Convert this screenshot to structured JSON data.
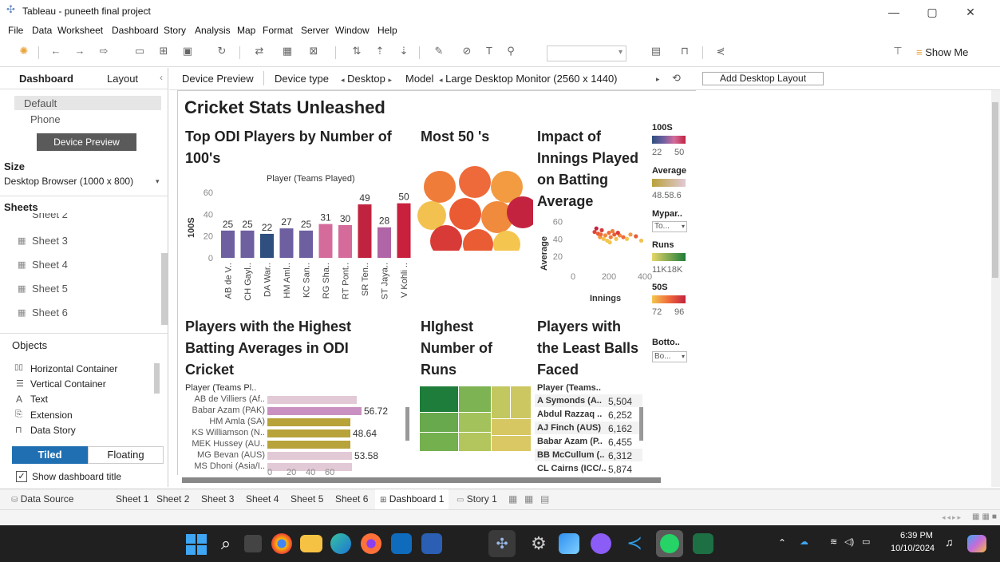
{
  "window": {
    "title": "Tableau - puneeth final project",
    "minimize": "—",
    "maximize": "▢",
    "close": "✕"
  },
  "menu": [
    "File",
    "Data",
    "Worksheet",
    "Dashboard",
    "Story",
    "Analysis",
    "Map",
    "Format",
    "Server",
    "Window",
    "Help"
  ],
  "toolbar": {
    "show_me": "Show Me"
  },
  "left": {
    "tab_dashboard": "Dashboard",
    "tab_layout": "Layout",
    "devices": [
      "Default",
      "Phone"
    ],
    "device_preview_btn": "Device Preview",
    "size_label": "Size",
    "size_value": "Desktop Browser (1000 x 800)",
    "sheets_label": "Sheets",
    "sheets": [
      "Sheet 2",
      "Sheet 3",
      "Sheet 4",
      "Sheet 5",
      "Sheet 6"
    ],
    "objects_label": "Objects",
    "objects": [
      "Horizontal Container",
      "Vertical Container",
      "Text",
      "Extension",
      "Data Story"
    ],
    "tiled": "Tiled",
    "floating": "Floating",
    "show_title": "Show dashboard title"
  },
  "devbar": {
    "device_preview": "Device Preview",
    "device_type_label": "Device type",
    "device_type": "Desktop",
    "model_label": "Model",
    "model": "Large Desktop Monitor (2560 x 1440)",
    "add_layout": "Add Desktop Layout"
  },
  "dashboard": {
    "title": "Cricket Stats Unleashed",
    "t1": "Top ODI Players by Number of 100's",
    "t1_sub": "Player (Teams Played)",
    "t1_ylabel": "100S",
    "t2": "Most 50 's",
    "t3": "Impact of Innings Played on Batting Average",
    "t3_ylabel": "Average",
    "t3_xlabel": "Innings",
    "t4": "Players with the Highest Batting Averages in ODI Cricket",
    "t4_header": "Player (Teams Pl..",
    "t5": "HIghest Number of Runs",
    "t6": "Players with the Least Balls Faced",
    "t6_header": "Player (Teams.."
  },
  "chart_data": [
    {
      "type": "bar",
      "title": "Top ODI Players by Number of 100's",
      "xlabel": "Player (Teams Played)",
      "ylabel": "100S",
      "categories": [
        "AB de V..",
        "CH Gayl..",
        "DA War..",
        "HM Aml..",
        "KC San..",
        "RG Sha..",
        "RT Pont..",
        "SR Ten..",
        "ST Jaya..",
        "V Kohli .."
      ],
      "values": [
        25,
        25,
        22,
        27,
        25,
        31,
        30,
        49,
        28,
        50
      ],
      "colors": [
        "#6e5fa0",
        "#6e5fa0",
        "#2f4f7f",
        "#6e5fa0",
        "#6e5fa0",
        "#d46b9b",
        "#d46b9b",
        "#c0233f",
        "#b065a6",
        "#c8203d"
      ],
      "ylim": [
        0,
        60
      ],
      "yticks": [
        0,
        20,
        40,
        60
      ]
    },
    {
      "type": "scatter",
      "title": "Impact of Innings Played on Batting Average",
      "xlabel": "Innings",
      "ylabel": "Average",
      "xticks": [
        0,
        200,
        400
      ],
      "yticks": [
        20,
        40,
        60
      ]
    },
    {
      "type": "bar",
      "title": "Players with the Highest Batting Averages in ODI Cricket",
      "categories": [
        "AB de Villiers (Af..",
        "Babar Azam (PAK)",
        "HM Amla (SA)",
        "KS Williamson (N..",
        "MEK Hussey (AU..",
        "MG Bevan (AUS)",
        "MS Dhoni (Asia/I.."
      ],
      "value_labels": [
        "",
        "56.72",
        "",
        "48.64",
        "",
        "53.58",
        ""
      ],
      "xticks": [
        0,
        20,
        40,
        60
      ]
    },
    {
      "type": "table",
      "title": "Players with the Least Balls Faced",
      "rows": [
        [
          "A Symonds (A..",
          "5,504"
        ],
        [
          "Abdul Razzaq ..",
          "6,252"
        ],
        [
          "AJ Finch (AUS)",
          "6,162"
        ],
        [
          "Babar Azam (P..",
          "6,455"
        ],
        [
          "BB McCullum (..",
          "6,312"
        ],
        [
          "CL Cairns (ICC/..",
          "5,874"
        ]
      ]
    }
  ],
  "legends": {
    "l100": {
      "title": "100S",
      "min": "22",
      "max": "50"
    },
    "avg": {
      "title": "Average",
      "range": "48.58.6"
    },
    "mypar": {
      "title": "Mypar..",
      "value": "To..."
    },
    "runs": {
      "title": "Runs",
      "range": "11K18K"
    },
    "l50": {
      "title": "50S",
      "min": "72",
      "max": "96"
    },
    "bottom": {
      "title": "Botto..",
      "value": "Bo..."
    }
  },
  "tabs": [
    "Data Source",
    "Sheet 1",
    "Sheet 2",
    "Sheet 3",
    "Sheet 4",
    "Sheet 5",
    "Sheet 6",
    "Dashboard 1",
    "Story 1"
  ],
  "clock": {
    "time": "6:39 PM",
    "date": "10/10/2024"
  }
}
